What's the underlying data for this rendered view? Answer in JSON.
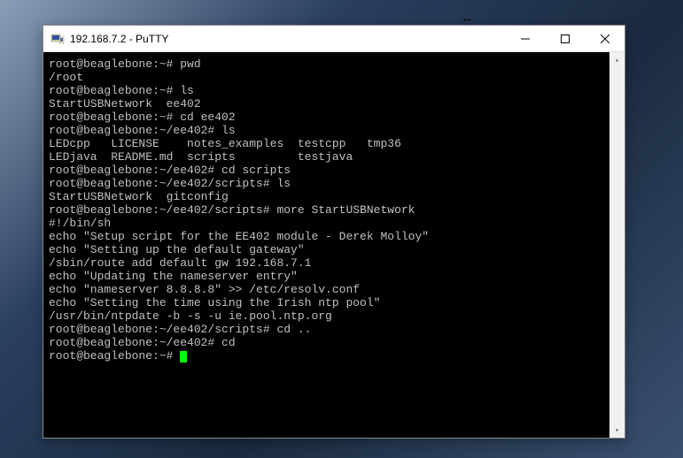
{
  "window": {
    "title": "192.168.7.2 - PuTTY"
  },
  "resize_indicator": "↔",
  "terminal": {
    "lines": [
      "root@beaglebone:~# pwd",
      "/root",
      "root@beaglebone:~# ls",
      "StartUSBNetwork  ee402",
      "root@beaglebone:~# cd ee402",
      "root@beaglebone:~/ee402# ls",
      "LEDcpp   LICENSE    notes_examples  testcpp   tmp36",
      "LEDjava  README.md  scripts         testjava",
      "root@beaglebone:~/ee402# cd scripts",
      "root@beaglebone:~/ee402/scripts# ls",
      "StartUSBNetwork  gitconfig",
      "root@beaglebone:~/ee402/scripts# more StartUSBNetwork",
      "#!/bin/sh",
      "echo \"Setup script for the EE402 module - Derek Molloy\"",
      "echo \"Setting up the default gateway\"",
      "/sbin/route add default gw 192.168.7.1",
      "",
      "echo \"Updating the nameserver entry\"",
      "echo \"nameserver 8.8.8.8\" >> /etc/resolv.conf",
      "",
      "echo \"Setting the time using the Irish ntp pool\"",
      "/usr/bin/ntpdate -b -s -u ie.pool.ntp.org",
      "root@beaglebone:~/ee402/scripts# cd ..",
      "root@beaglebone:~/ee402# cd",
      "root@beaglebone:~# "
    ]
  },
  "scrollbar": {
    "up": "▴",
    "down": "▾"
  }
}
